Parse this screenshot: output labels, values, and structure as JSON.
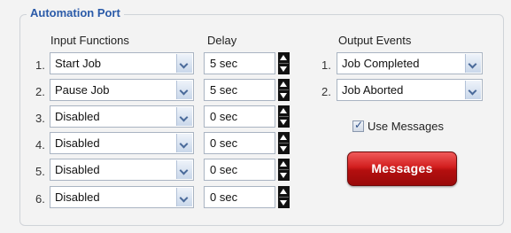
{
  "group_title": "Automation Port",
  "headers": {
    "input_functions": "Input Functions",
    "delay": "Delay",
    "output_events": "Output Events"
  },
  "inputs": [
    {
      "num": "1.",
      "function": "Start Job",
      "delay": "5 sec"
    },
    {
      "num": "2.",
      "function": "Pause Job",
      "delay": "5 sec"
    },
    {
      "num": "3.",
      "function": "Disabled",
      "delay": "0 sec"
    },
    {
      "num": "4.",
      "function": "Disabled",
      "delay": "0 sec"
    },
    {
      "num": "5.",
      "function": "Disabled",
      "delay": "0 sec"
    },
    {
      "num": "6.",
      "function": "Disabled",
      "delay": "0 sec"
    }
  ],
  "outputs": [
    {
      "num": "1.",
      "event": "Job Completed"
    },
    {
      "num": "2.",
      "event": "Job Aborted"
    }
  ],
  "use_messages": {
    "label": "Use Messages",
    "checked": true
  },
  "messages_button": {
    "label": "Messages"
  },
  "colors": {
    "title": "#2a5aa8",
    "button": "#c8161b"
  }
}
